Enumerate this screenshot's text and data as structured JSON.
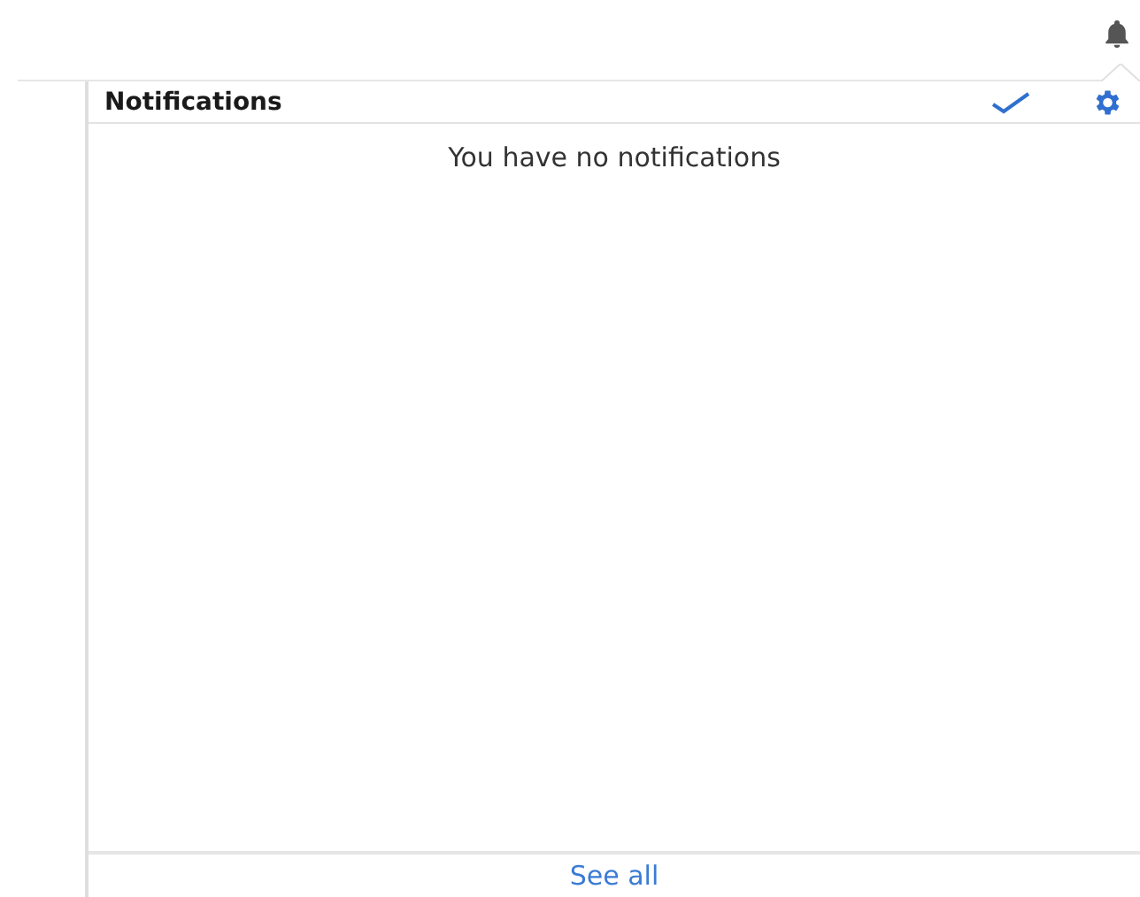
{
  "panel": {
    "title": "Notifications",
    "empty_message": "You have no notifications",
    "footer_link": "See all"
  }
}
